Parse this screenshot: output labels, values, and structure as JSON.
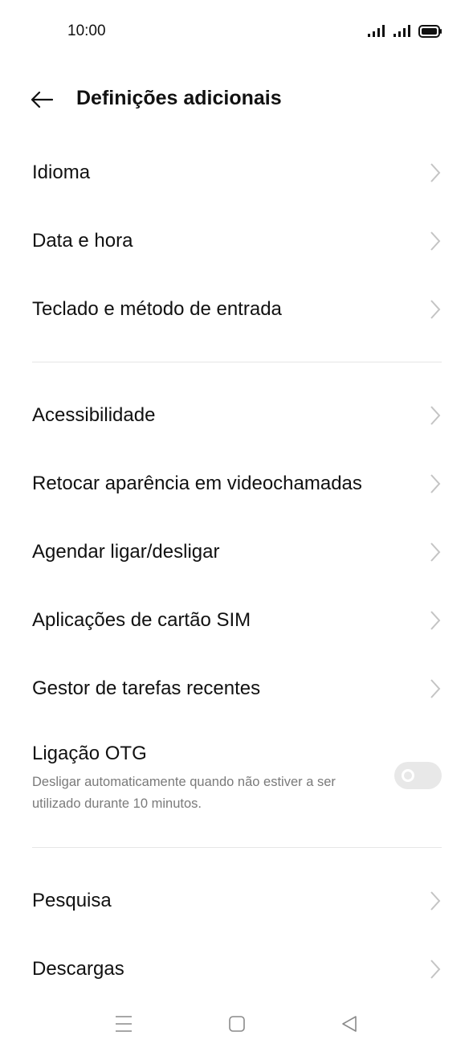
{
  "status_bar": {
    "time": "10:00"
  },
  "header": {
    "title": "Definições adicionais"
  },
  "group1": [
    {
      "label": "Idioma"
    },
    {
      "label": "Data e hora"
    },
    {
      "label": "Teclado e método de entrada"
    }
  ],
  "group2": [
    {
      "label": "Acessibilidade"
    },
    {
      "label": "Retocar aparência em videochamadas"
    },
    {
      "label": "Agendar ligar/desligar"
    },
    {
      "label": "Aplicações de cartão SIM"
    },
    {
      "label": "Gestor de tarefas recentes"
    }
  ],
  "otg": {
    "title": "Ligação OTG",
    "description": "Desligar automaticamente quando não estiver a ser utilizado durante 10 minutos.",
    "enabled": false
  },
  "group3": [
    {
      "label": "Pesquisa"
    },
    {
      "label": "Descargas"
    }
  ],
  "icons": {
    "signal": "signal-icon",
    "battery": "battery-icon",
    "back": "back-arrow-icon",
    "chevron": "chevron-right-icon",
    "nav_menu": "menu-icon",
    "nav_home": "home-square-icon",
    "nav_back": "back-triangle-icon"
  },
  "colors": {
    "text": "#111111",
    "secondary": "#7a7a7a",
    "chevron": "#c4c4c4",
    "divider": "#e6e6e6",
    "toggle_off": "#e8e8e8"
  }
}
